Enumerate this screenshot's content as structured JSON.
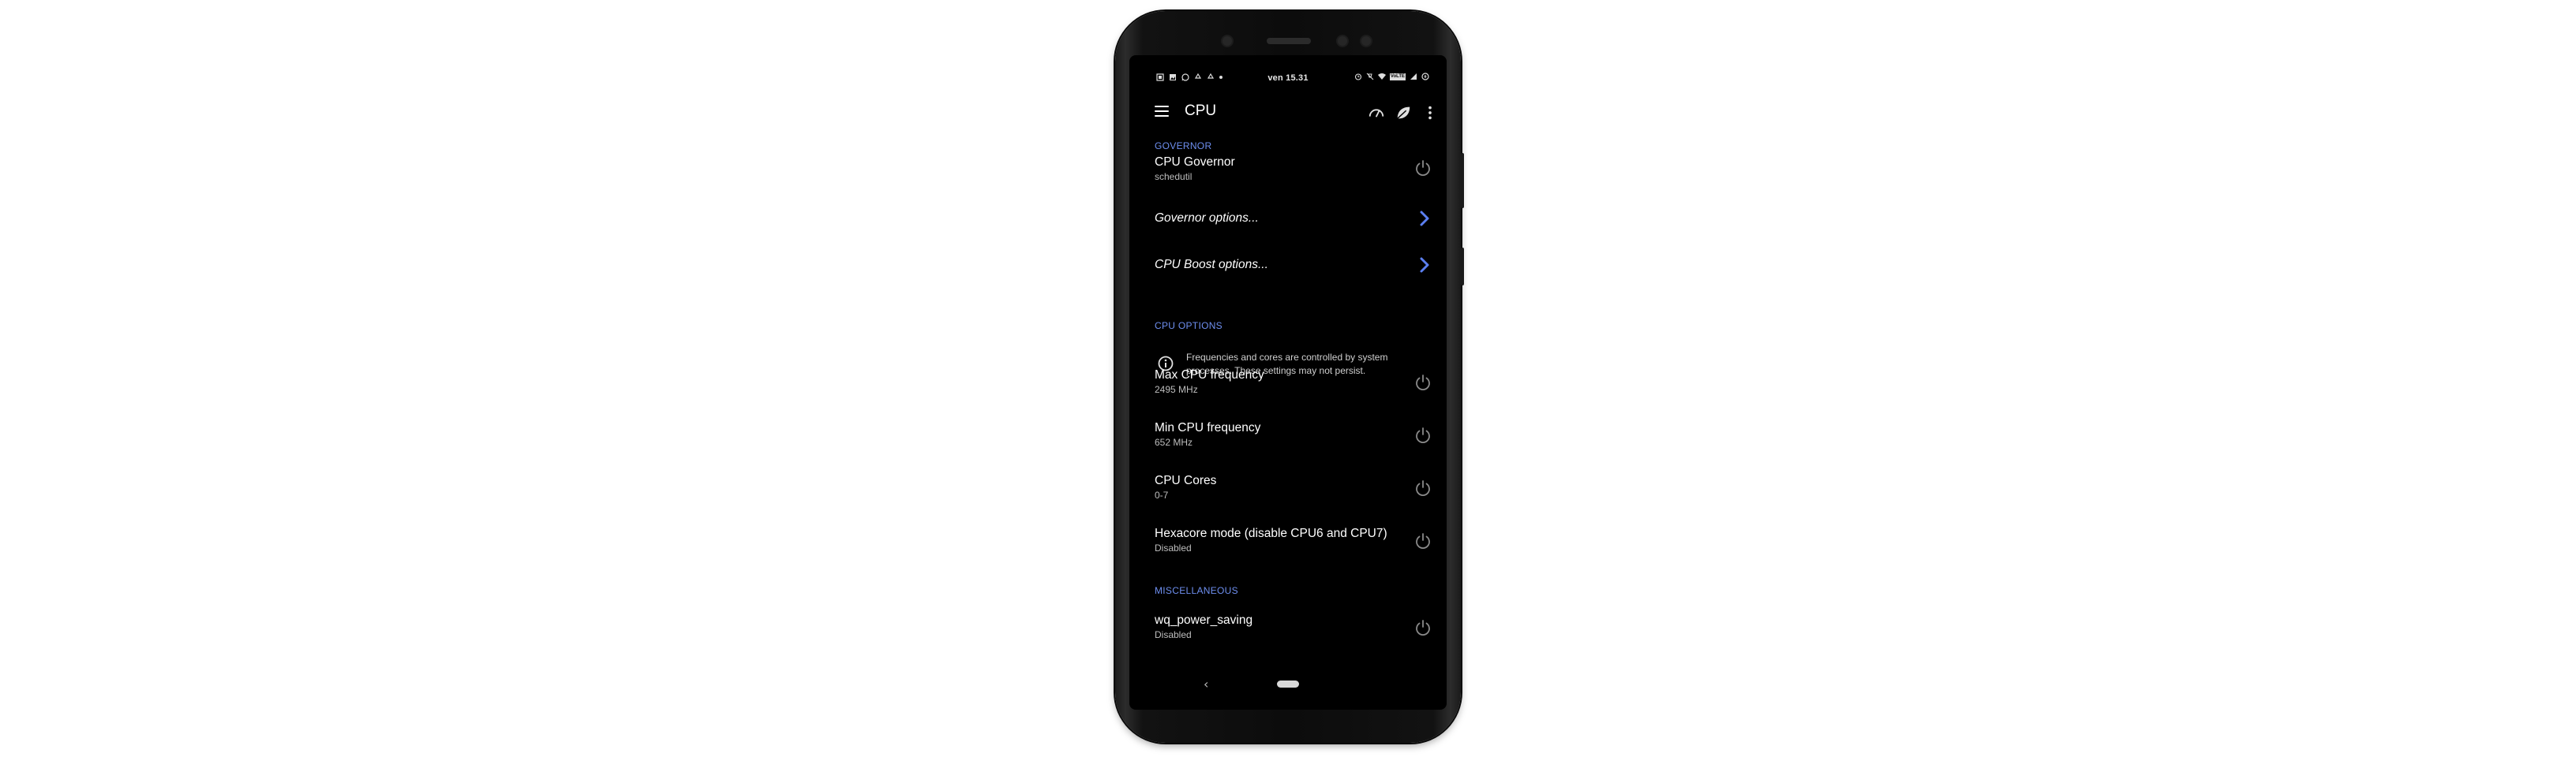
{
  "status_bar": {
    "time": "ven 15.31",
    "left_icons": [
      "notification-icon",
      "gallery-icon",
      "whatsapp-icon",
      "recycle-icon",
      "recycle-icon",
      "more-dot-icon"
    ],
    "right_icons": [
      "alarm-icon",
      "silent-icon",
      "wifi-icon",
      "volte-icon",
      "signal-icon",
      "battery-icon"
    ],
    "volte_label": "VoLTE"
  },
  "app_bar": {
    "title": "CPU",
    "actions": [
      "speedometer-icon",
      "leaf-icon",
      "more-vert-icon"
    ]
  },
  "sections": {
    "governor": {
      "header": "GOVERNOR",
      "cpu_governor": {
        "title": "CPU Governor",
        "value": "schedutil"
      },
      "governor_options": "Governor options...",
      "cpu_boost_options": "CPU Boost options..."
    },
    "cpu_options": {
      "header": "CPU OPTIONS",
      "info": "Frequencies and cores are controlled by system processes. These settings may not persist.",
      "max_freq": {
        "title": "Max CPU frequency",
        "value": "2495 MHz"
      },
      "min_freq": {
        "title": "Min CPU frequency",
        "value": "652 MHz"
      },
      "cores": {
        "title": "CPU Cores",
        "value": "0-7"
      },
      "hexacore": {
        "title": "Hexacore mode (disable CPU6 and CPU7)",
        "value": "Disabled"
      }
    },
    "misc": {
      "header": "MISCELLANEOUS",
      "wq_power": {
        "title": "wq_power_saving",
        "value": "Disabled"
      }
    }
  },
  "nav_bar": {
    "back": "‹"
  },
  "colors": {
    "accent": "#6e8ff0",
    "chevron": "#5b7ff0",
    "background": "#000000",
    "power_icon": "#8a8a8a"
  }
}
